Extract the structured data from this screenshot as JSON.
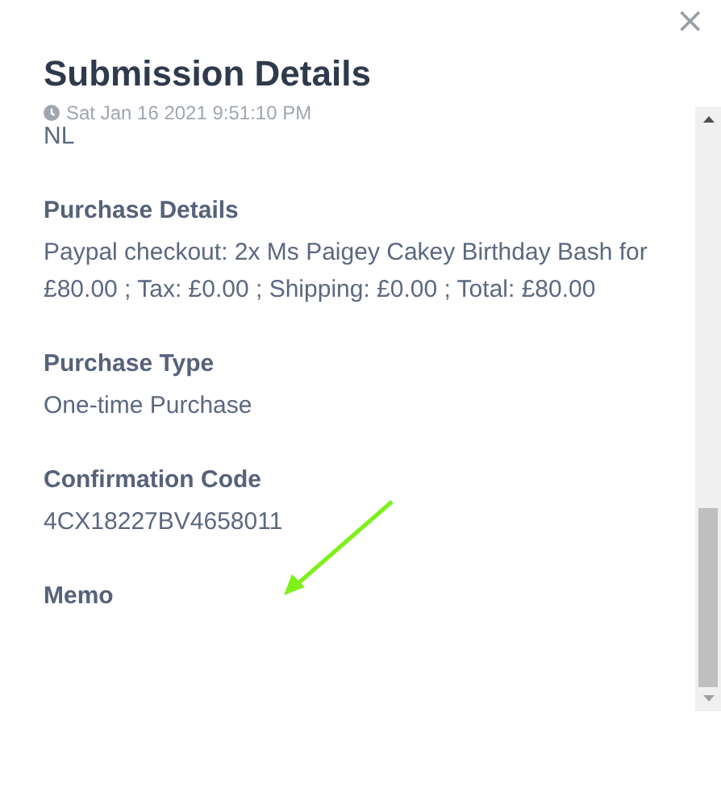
{
  "close_button": "×",
  "title": "Submission Details",
  "timestamp": "Sat Jan 16 2021 9:51:10 PM",
  "fields": [
    {
      "value": "NL"
    },
    {
      "label": "Purchase Details",
      "value": "Paypal checkout: 2x Ms Paigey Cakey Birthday Bash for £80.00 ; Tax: £0.00 ; Shipping: £0.00 ; Total: £80.00"
    },
    {
      "label": "Purchase Type",
      "value": "One-time Purchase"
    },
    {
      "label": "Confirmation Code",
      "value": "4CX18227BV4658011"
    },
    {
      "label": "Memo"
    }
  ]
}
